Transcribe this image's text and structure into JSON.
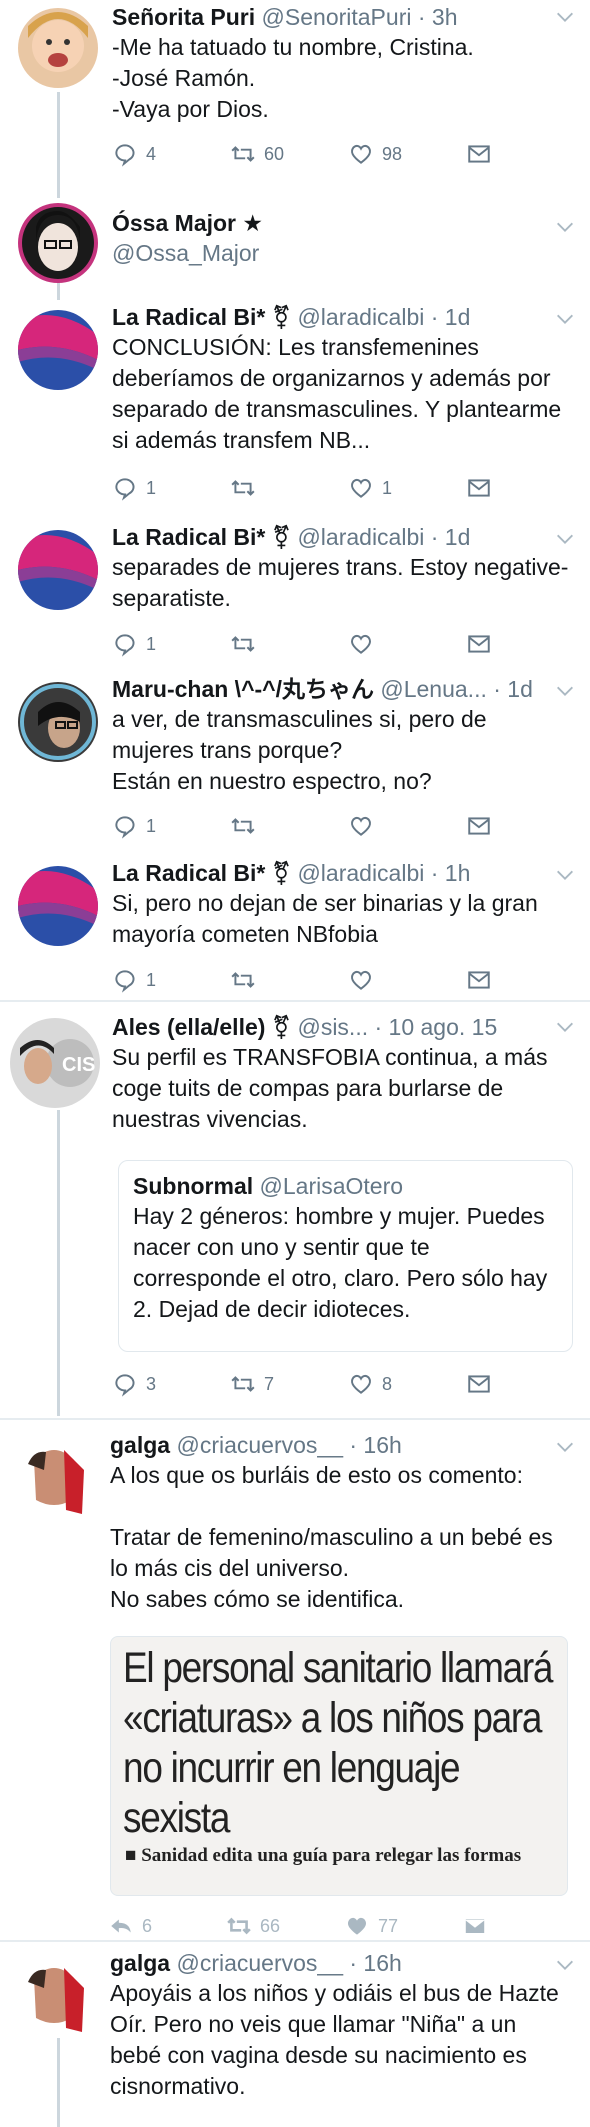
{
  "tweets": [
    {
      "name": "Señorita Puri",
      "meta": "@SenoritaPuri · 3h",
      "text": "-Me ha tatuado tu nombre, Cristina.\n-José Ramón.\n-Vaya por Dios.",
      "replies": "4",
      "retweets": "60",
      "likes": "98"
    },
    {
      "name": "Óssa Major ★",
      "handle": "@Ossa_Major"
    },
    {
      "name": "La Radical Bi* ⚧",
      "meta": "@laradicalbi · 1d",
      "text": "CONCLUSIÓN: Les transfemenines deberíamos de organizarnos y además por separado de transmasculines. Y plantearme si además transfem NB...",
      "replies": "1",
      "retweets": "",
      "likes": "1"
    },
    {
      "name": "La Radical Bi* ⚧",
      "meta": "@laradicalbi · 1d",
      "text": "separades de mujeres trans. Estoy negative-separatiste.",
      "replies": "1",
      "retweets": "",
      "likes": ""
    },
    {
      "name": "Maru-chan \\^-^/丸ちゃん",
      "meta": "@Lenua... · 1d",
      "text": "a ver, de transmasculines si, pero de mujeres trans porque?\nEstán en nuestro espectro, no?",
      "replies": "1",
      "retweets": "",
      "likes": ""
    },
    {
      "name": "La Radical Bi* ⚧",
      "meta": "@laradicalbi · 1h",
      "text": "Si, pero no dejan de ser binarias y la gran mayoría cometen NBfobia",
      "replies": "1",
      "retweets": "",
      "likes": ""
    },
    {
      "name": "Ales (ella/elle) ⚧",
      "meta": "@sis... · 10 ago. 15",
      "text": "Su perfil es TRANSFOBIA continua, a más coge tuits de compas para burlarse de nuestras vivencias.",
      "quote": {
        "name": "Subnormal",
        "handle": "@LarisaOtero",
        "text": "Hay 2 géneros: hombre y mujer. Puedes nacer con uno y sentir que te corresponde el otro, claro. Pero sólo hay 2. Dejad de decir idioteces."
      },
      "replies": "3",
      "retweets": "7",
      "likes": "8"
    },
    {
      "name": "galga",
      "meta": "@criacuervos__ · 16h",
      "text": "A los que os burláis de esto os comento:\n\nTratar de femenino/masculino a un bebé es lo más cis del universo.\nNo sabes cómo se identifica.",
      "image": {
        "headline": "El personal sanitario llamará «criaturas» a los niños para no incurrir en lenguaje sexista",
        "sub": "■ Sanidad edita una guía para relegar las formas"
      },
      "replies": "6",
      "retweets": "66",
      "likes": "77"
    },
    {
      "name": "galga",
      "meta": "@criacuervos__ · 16h",
      "text": "Apoyáis a los niños y odiáis el bus de Hazte Oír. Pero no veis que llamar \"Niña\" a un bebé con vagina desde su nacimiento es cisnormativo."
    }
  ],
  "colors": {
    "text": "#14171a",
    "meta": "#657786",
    "thread_line": "#ccd6dd",
    "divider": "#e6ecf0",
    "muted_icon": "#aab8c2"
  }
}
